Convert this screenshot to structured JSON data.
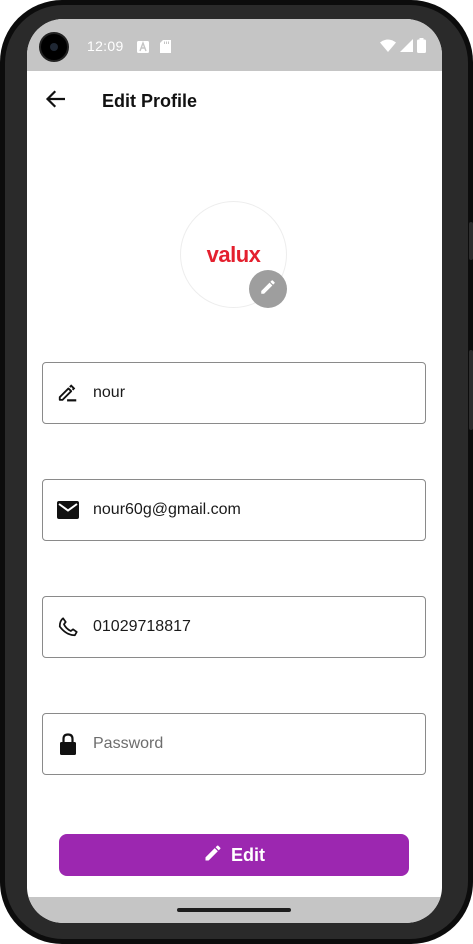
{
  "status_bar": {
    "time": "12:09",
    "icons": [
      "keyboard-a-icon",
      "sd-card-icon",
      "wifi-icon",
      "signal-icon",
      "battery-icon"
    ]
  },
  "app_bar": {
    "back_icon": "arrow-back-icon",
    "title": "Edit Profile"
  },
  "avatar": {
    "logo_text": "valux",
    "edit_icon": "pencil-icon"
  },
  "form": {
    "name": {
      "icon": "edit-note-icon",
      "value": "nour",
      "placeholder": ""
    },
    "email": {
      "icon": "mail-icon",
      "value": "nour60g@gmail.com",
      "placeholder": ""
    },
    "phone": {
      "icon": "phone-icon",
      "value": "01029718817",
      "placeholder": ""
    },
    "password": {
      "icon": "lock-icon",
      "value": "",
      "placeholder": "Password"
    }
  },
  "edit_button": {
    "icon": "pencil-icon",
    "label": "Edit"
  },
  "colors": {
    "accent": "#9c27b0",
    "brand": "#e4202e",
    "system_bar": "#c5c5c5"
  }
}
